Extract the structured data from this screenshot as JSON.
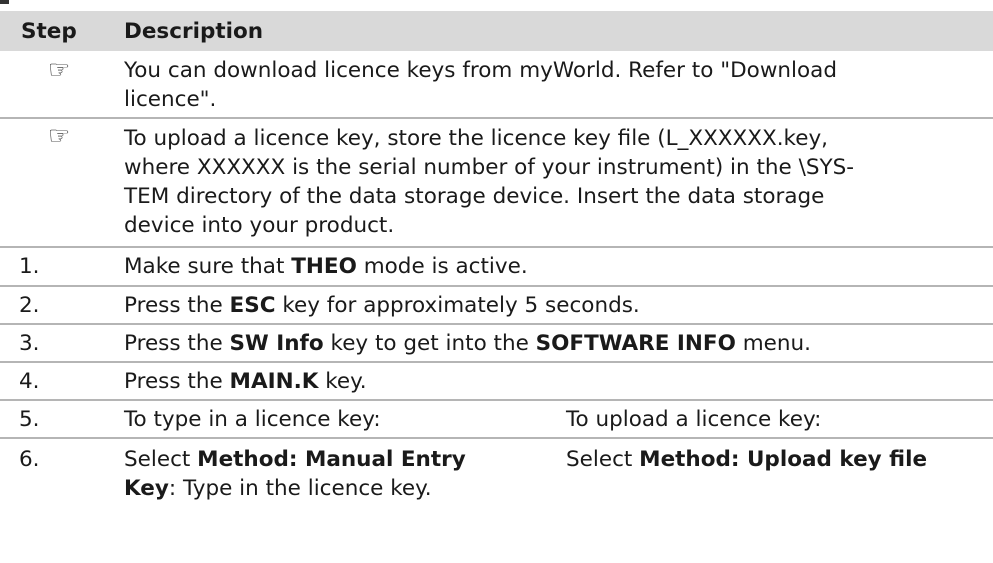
{
  "table": {
    "header": {
      "step": "Step",
      "description": "Description"
    },
    "rows": [
      {
        "type": "note",
        "icon": "pointing-hand-icon",
        "text_a": "You can download licence keys from myWorld. Refer to \"Download",
        "text_b": "licence\"."
      },
      {
        "type": "note",
        "icon": "pointing-hand-icon",
        "lines": [
          "To upload a licence key, store the licence key file (L_XXXXXX.key,",
          "where XXXXXX is the serial number of your instrument) in the \\SYS-",
          "TEM directory of the data storage device. Insert the data storage",
          "device into your product."
        ]
      },
      {
        "step": "1.",
        "pre": "Make sure that ",
        "bold": "THEO",
        "post": " mode is active."
      },
      {
        "step": "2.",
        "pre": "Press the ",
        "bold": "ESC",
        "post": " key for approximately 5 seconds."
      },
      {
        "step": "3.",
        "pre": "Press the ",
        "bold": "SW Info",
        "mid": " key to get into the ",
        "bold2": "SOFTWARE INFO",
        "post": " menu."
      },
      {
        "step": "4.",
        "pre": "Press the ",
        "bold": "MAIN.K",
        "post": " key."
      },
      {
        "step": "5.",
        "left": "To type in a licence key:",
        "right": "To upload a licence key:"
      },
      {
        "step": "6.",
        "left_pre": "Select ",
        "left_bold1": "Method: Manual Entry",
        "left_bold2": "Key",
        "left_post": ": Type in the licence key.",
        "right_pre": "Select ",
        "right_bold": "Method: Upload key file"
      }
    ]
  }
}
